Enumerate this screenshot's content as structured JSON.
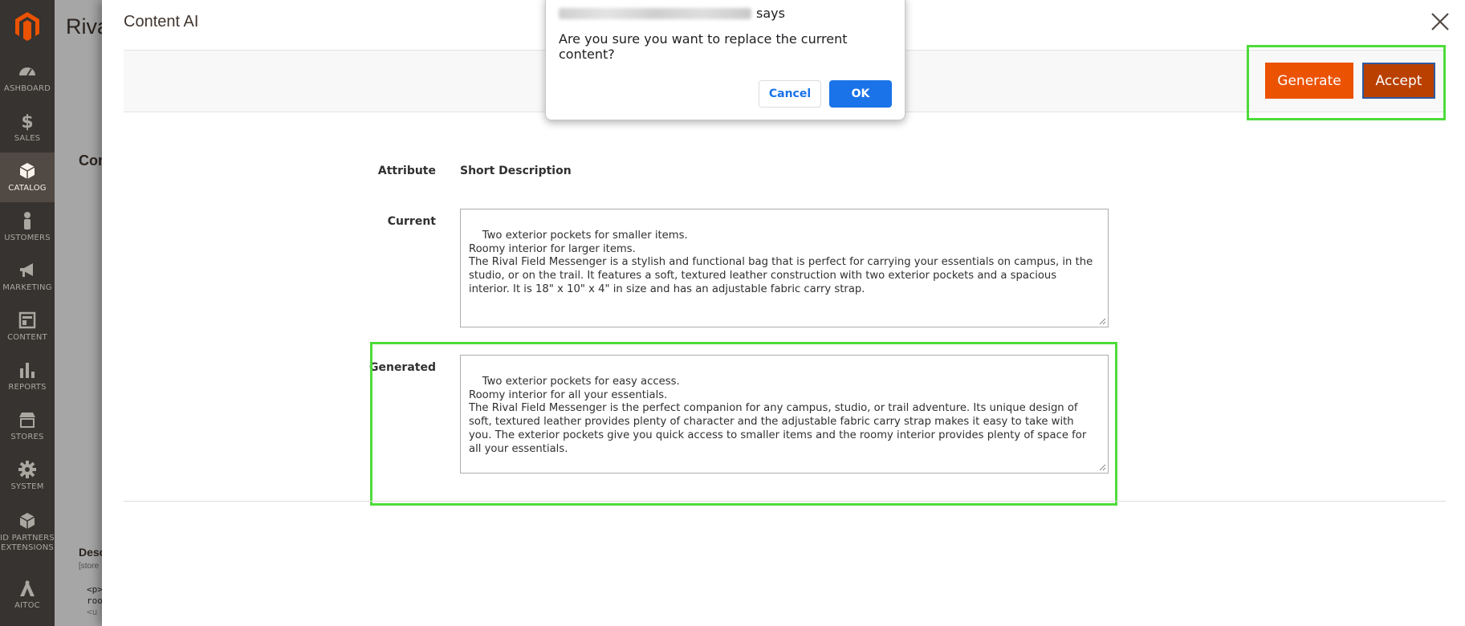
{
  "sidebar": {
    "items": [
      {
        "label": "ASHBOARD",
        "icon": "dashboard-icon"
      },
      {
        "label": "SALES",
        "icon": "dollar-icon"
      },
      {
        "label": "CATALOG",
        "icon": "box-icon"
      },
      {
        "label": "USTOMERS",
        "icon": "person-icon"
      },
      {
        "label": "MARKETING",
        "icon": "megaphone-icon"
      },
      {
        "label": "CONTENT",
        "icon": "layout-icon"
      },
      {
        "label": "REPORTS",
        "icon": "bar-chart-icon"
      },
      {
        "label": "STORES",
        "icon": "store-icon"
      },
      {
        "label": "SYSTEM",
        "icon": "gear-icon"
      },
      {
        "label": "ID PARTNERS EXTENSIONS",
        "icon": "cube-icon"
      },
      {
        "label": "AITOC",
        "icon": "aitoc-icon"
      }
    ],
    "active_index": 2
  },
  "background_page": {
    "title": "Riva",
    "section": "Con",
    "desc_heading": "Desc",
    "store_note": "[store",
    "code_lines": [
      "<p>",
      "roo",
      "<u"
    ]
  },
  "modal": {
    "title": "Content AI",
    "toolbar": {
      "generate_label": "Generate",
      "accept_label": "Accept"
    },
    "form": {
      "attribute_label": "Attribute",
      "attribute_value": "Short Description",
      "current_label": "Current",
      "current_text": "Two exterior pockets for smaller items.\nRoomy interior for larger items.\nThe Rival Field Messenger is a stylish and functional bag that is perfect for carrying your essentials on campus, in the studio, or on the trail. It features a soft, textured leather construction with two exterior pockets and a spacious interior. It is 18\" x 10\" x 4\" in size and has an adjustable fabric carry strap.",
      "generated_label": "Generated",
      "generated_text": "Two exterior pockets for easy access.\nRoomy interior for all your essentials.\nThe Rival Field Messenger is the perfect companion for any campus, studio, or trail adventure. Its unique design of soft, textured leather provides plenty of character and the adjustable fabric carry strap makes it easy to take with you. The exterior pockets give you quick access to smaller items and the roomy interior provides plenty of space for all your essentials."
    }
  },
  "dialog": {
    "origin_suffix": "says",
    "message": "Are you sure you want to replace the current content?",
    "cancel_label": "Cancel",
    "ok_label": "OK"
  },
  "colors": {
    "sidebar_bg": "#373330",
    "accent_orange": "#eb5202",
    "accept_bg": "#ba4000",
    "highlight_green": "#4ddc3a",
    "dialog_blue": "#1a73e8"
  }
}
